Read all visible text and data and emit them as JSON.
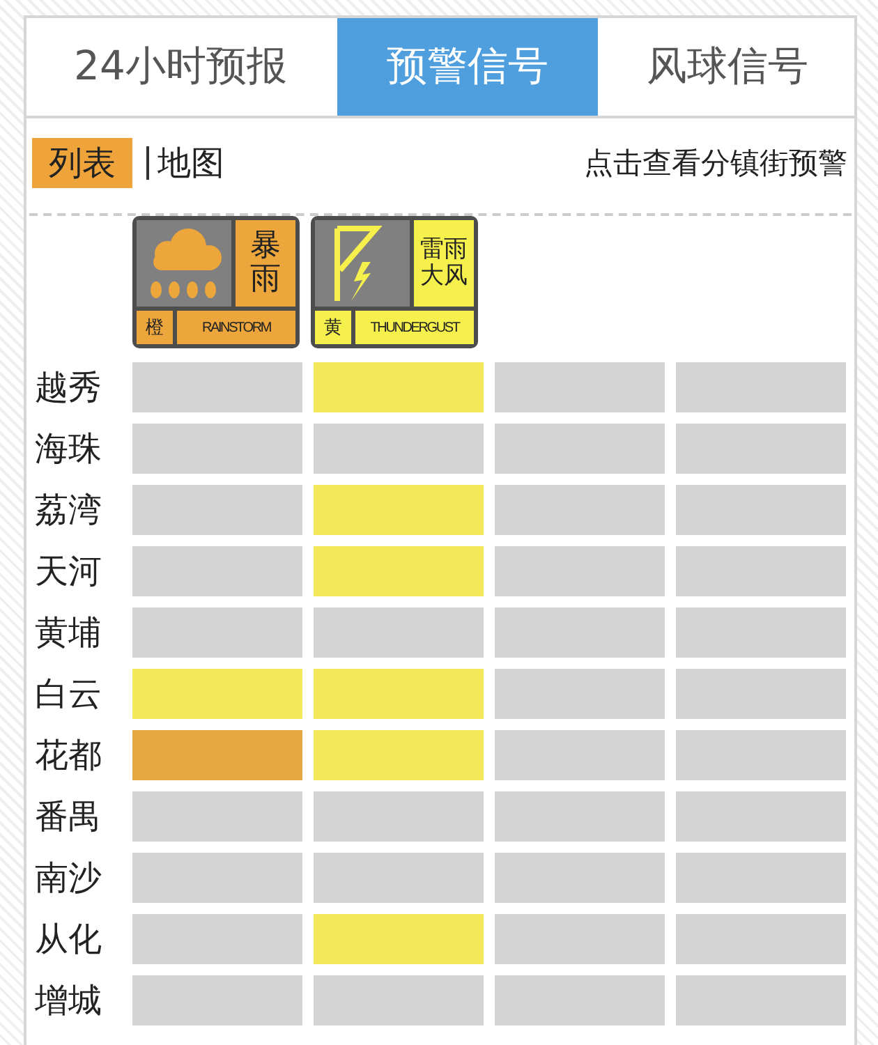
{
  "tabs": [
    {
      "label": "24小时预报",
      "selected": false
    },
    {
      "label": "预警信号",
      "selected": true
    },
    {
      "label": "风球信号",
      "selected": false
    }
  ],
  "view_switch": [
    {
      "label": "列表",
      "selected": true
    },
    {
      "label": "地图",
      "selected": false
    }
  ],
  "town_link": "点击查看分镇街预警",
  "signals": [
    {
      "kind": "rainstorm",
      "title": "暴雨",
      "grade": "橙",
      "label": "RAINSTORM",
      "color": "#eca63c"
    },
    {
      "kind": "thunder",
      "title": "雷雨大风",
      "grade": "黄",
      "label": "THUNDERGUST",
      "color": "#f6f04c"
    }
  ],
  "rows": [
    {
      "district": "越秀",
      "cells": [
        {
          "color": "#d4d4d4"
        },
        {
          "color": "#f3e75a"
        },
        {
          "color": "#d4d4d4"
        },
        {
          "color": "#d4d4d4"
        }
      ]
    },
    {
      "district": "海珠",
      "cells": [
        {
          "color": "#d4d4d4"
        },
        {
          "color": "#d4d4d4"
        },
        {
          "color": "#d4d4d4"
        },
        {
          "color": "#d4d4d4"
        }
      ]
    },
    {
      "district": "荔湾",
      "cells": [
        {
          "color": "#d4d4d4"
        },
        {
          "color": "#f3e75a"
        },
        {
          "color": "#d4d4d4"
        },
        {
          "color": "#d4d4d4"
        }
      ]
    },
    {
      "district": "天河",
      "cells": [
        {
          "color": "#d4d4d4"
        },
        {
          "color": "#f3e75a"
        },
        {
          "color": "#d4d4d4"
        },
        {
          "color": "#d4d4d4"
        }
      ]
    },
    {
      "district": "黄埔",
      "cells": [
        {
          "color": "#d4d4d4"
        },
        {
          "color": "#d4d4d4"
        },
        {
          "color": "#d4d4d4"
        },
        {
          "color": "#d4d4d4"
        }
      ]
    },
    {
      "district": "白云",
      "cells": [
        {
          "color": "#f3e75a"
        },
        {
          "color": "#f3e75a"
        },
        {
          "color": "#d4d4d4"
        },
        {
          "color": "#d4d4d4"
        }
      ]
    },
    {
      "district": "花都",
      "cells": [
        {
          "color": "#e5a843"
        },
        {
          "color": "#f3e75a"
        },
        {
          "color": "#d4d4d4"
        },
        {
          "color": "#d4d4d4"
        }
      ]
    },
    {
      "district": "番禺",
      "cells": [
        {
          "color": "#d4d4d4"
        },
        {
          "color": "#d4d4d4"
        },
        {
          "color": "#d4d4d4"
        },
        {
          "color": "#d4d4d4"
        }
      ]
    },
    {
      "district": "南沙",
      "cells": [
        {
          "color": "#d4d4d4"
        },
        {
          "color": "#d4d4d4"
        },
        {
          "color": "#d4d4d4"
        },
        {
          "color": "#d4d4d4"
        }
      ]
    },
    {
      "district": "从化",
      "cells": [
        {
          "color": "#d4d4d4"
        },
        {
          "color": "#f3e75a"
        },
        {
          "color": "#d4d4d4"
        },
        {
          "color": "#d4d4d4"
        }
      ]
    },
    {
      "district": "增城",
      "cells": [
        {
          "color": "#d4d4d4"
        },
        {
          "color": "#d4d4d4"
        },
        {
          "color": "#d4d4d4"
        },
        {
          "color": "#d4d4d4"
        }
      ]
    }
  ]
}
